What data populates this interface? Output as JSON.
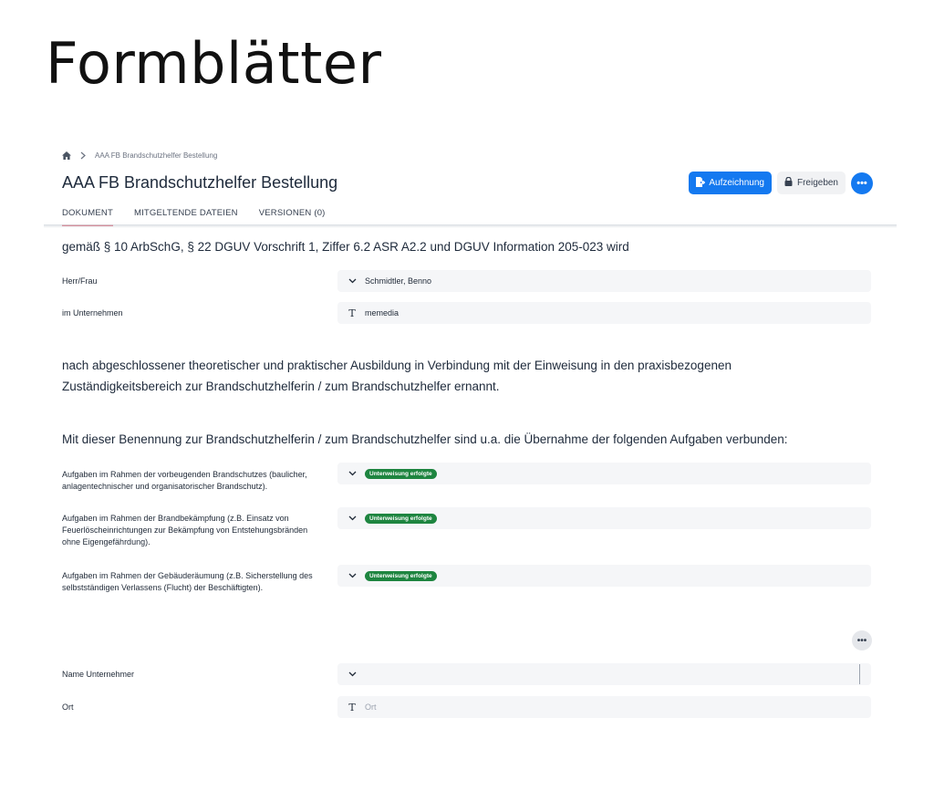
{
  "hero": {
    "title": "Formblätter"
  },
  "breadcrumb": {
    "home_icon": "home-icon",
    "separator_icon": "chevron-right-icon",
    "current": "AAA FB Brandschutzhelfer Bestellung"
  },
  "document": {
    "title": "AAA FB Brandschutzhelfer Bestellung"
  },
  "actions": {
    "record_label": "Aufzeichnung",
    "record_icon": "file-record-icon",
    "release_label": "Freigeben",
    "release_icon": "lock-icon",
    "more_label": "•••"
  },
  "tabs": [
    {
      "label": "DOKUMENT",
      "active": true
    },
    {
      "label": "MITGELTENDE DATEIEN",
      "active": false
    },
    {
      "label": "VERSIONEN (0)",
      "active": false
    }
  ],
  "content": {
    "intro": "gemäß § 10 ArbSchG, § 22 DGUV Vorschrift 1, Ziffer 6.2 ASR A2.2 und DGUV Information 205-023 wird",
    "fields_top": [
      {
        "label": "Herr/Frau",
        "icon": "chevron-down-icon",
        "value": "Schmidtler, Benno"
      },
      {
        "label": "im Unternehmen",
        "icon": "text-field-icon",
        "value": "memedia"
      }
    ],
    "appointment": "nach abgeschlossener theoretischer und praktischer Ausbildung in Verbindung mit der Einweisung in den praxisbezogenen Zuständigkeitsbereich zur Brandschutzhelferin / zum Brandschutzhelfer ernannt.",
    "tasks_heading": "Mit dieser Benennung zur Brandschutzhelferin / zum Brandschutzhelfer sind u.a. die Übernahme der folgenden Aufgaben verbunden:",
    "tasks": [
      {
        "label": "Aufgaben im Rahmen der vorbeugenden Brandschutzes (baulicher, anlagentechnischer und organisatorischer Brandschutz).",
        "status": "Unterweisung erfolgte"
      },
      {
        "label": "Aufgaben im Rahmen der Brandbekämpfung (z.B. Einsatz von Feuerlöscheinrichtungen zur Bekämpfung von Entstehungsbränden ohne Eigengefährdung).",
        "status": "Unterweisung erfolgte"
      },
      {
        "label": "Aufgaben im Rahmen der Gebäuderäumung (z.B. Sicherstellung des selbstständigen Verlassens (Flucht) der Beschäftigten).",
        "status": "Unterweisung erfolgte"
      }
    ],
    "more_label": "•••",
    "fields_bottom": [
      {
        "label": "Name Unternehmer",
        "icon": "chevron-down-icon",
        "value": ""
      },
      {
        "label": "Ort",
        "icon": "text-field-icon",
        "placeholder": "Ort"
      }
    ]
  },
  "colors": {
    "primary": "#1479f0",
    "tab_active": "#d0112b",
    "status_badge": "#1e8540"
  }
}
